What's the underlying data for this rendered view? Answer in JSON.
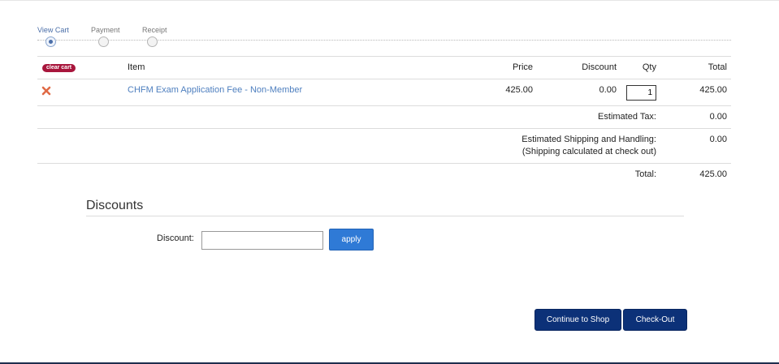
{
  "steps": [
    {
      "label": "View Cart",
      "active": true
    },
    {
      "label": "Payment",
      "active": false
    },
    {
      "label": "Receipt",
      "active": false
    }
  ],
  "cart": {
    "clear_cart_label": "clear cart",
    "headers": {
      "item": "Item",
      "price": "Price",
      "discount": "Discount",
      "qty": "Qty",
      "total": "Total"
    },
    "rows": [
      {
        "item": "CHFM Exam Application Fee - Non-Member",
        "price": "425.00",
        "discount": "0.00",
        "qty": "1",
        "total": "425.00"
      }
    ],
    "estimated_tax_label": "Estimated Tax:",
    "estimated_tax_value": "0.00",
    "shipping_label_1": "Estimated Shipping and Handling:",
    "shipping_label_2": "(Shipping calculated at check out)",
    "shipping_value": "0.00",
    "total_label": "Total:",
    "total_value": "425.00"
  },
  "discounts": {
    "title": "Discounts",
    "label": "Discount:",
    "input_value": "",
    "apply_label": "apply"
  },
  "actions": {
    "continue_label": "Continue to Shop",
    "checkout_label": "Check-Out"
  },
  "colors": {
    "accent_blue": "#2f7ad6",
    "dark_navy": "#0c3178",
    "clear_cart_red": "#a8163c",
    "link_blue": "#4e7fbf"
  }
}
